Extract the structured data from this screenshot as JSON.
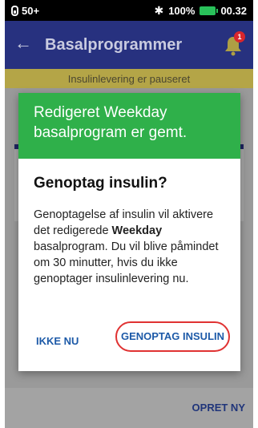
{
  "statusbar": {
    "pod_level": "50+",
    "bluetooth_glyph": "✱",
    "battery_percent": "100%",
    "time": "00.32"
  },
  "appbar": {
    "back_glyph": "←",
    "title": "Basalprogrammer",
    "notification_count": "1"
  },
  "banner": {
    "text": "Insulinlevering er pauseret"
  },
  "footer": {
    "create_new": "OPRET NY"
  },
  "dialog": {
    "header": "Redigeret Weekday basalprogram er gemt.",
    "question": "Genoptag insulin?",
    "body_prefix": "Genoptagelse af insulin vil aktivere det redigerede ",
    "body_bold": "Weekday",
    "body_suffix": " basalprogram. Du vil blive påmindet om 30 minutter, hvis du ikke genoptager insulinlevering nu.",
    "later_label": "IKKE NU",
    "resume_label": "GENOPTAG INSULIN"
  },
  "colors": {
    "appbar": "#27317f",
    "dialog_header": "#2fb04a",
    "button_text": "#1d5aa8",
    "highlight_ring": "#e03232",
    "banner": "#b4a547",
    "badge": "#d9262c"
  }
}
